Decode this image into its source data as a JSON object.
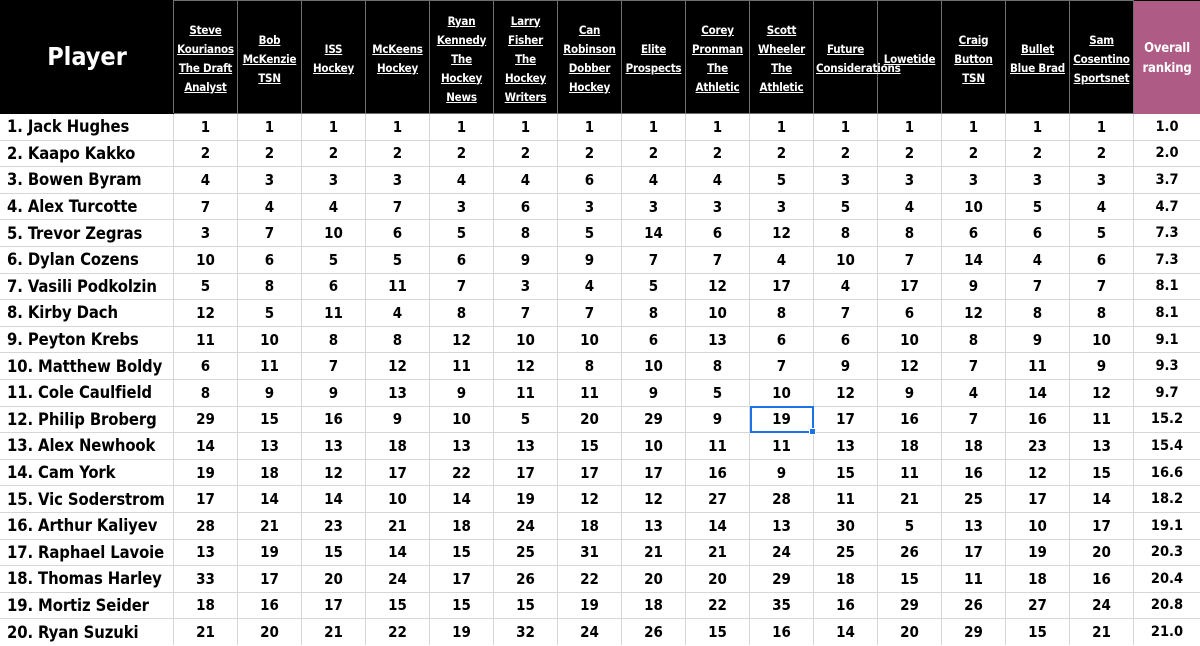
{
  "table": {
    "player_column_header": "Player",
    "overall_column_header": "Overall ranking",
    "accent_header_color": "#AE5C85",
    "header_bg_color": "#000000",
    "selection_color": "#1a73e8",
    "source_columns": [
      "Steve Kourianos The Draft Analyst",
      "Bob McKenzie TSN",
      "ISS Hockey",
      "McKeens Hockey",
      "Ryan Kennedy The Hockey News",
      "Larry Fisher The Hockey Writers",
      "Can Robinson Dobber Hockey",
      "Elite Prospects",
      "Corey Pronman The Athletic",
      "Scott Wheeler The Athletic",
      "Future Considerations",
      "Lowetide",
      "Craig Button TSN",
      "Bullet Blue Brad",
      "Sam Cosentino Sportsnet"
    ],
    "rows": [
      {
        "player": "1. Jack Hughes",
        "values": [
          "1",
          "1",
          "1",
          "1",
          "1",
          "1",
          "1",
          "1",
          "1",
          "1",
          "1",
          "1",
          "1",
          "1",
          "1"
        ],
        "overall": "1.0"
      },
      {
        "player": "2. Kaapo Kakko",
        "values": [
          "2",
          "2",
          "2",
          "2",
          "2",
          "2",
          "2",
          "2",
          "2",
          "2",
          "2",
          "2",
          "2",
          "2",
          "2"
        ],
        "overall": "2.0"
      },
      {
        "player": "3. Bowen Byram",
        "values": [
          "4",
          "3",
          "3",
          "3",
          "4",
          "4",
          "6",
          "4",
          "4",
          "5",
          "3",
          "3",
          "3",
          "3",
          "3"
        ],
        "overall": "3.7"
      },
      {
        "player": "4. Alex Turcotte",
        "values": [
          "7",
          "4",
          "4",
          "7",
          "3",
          "6",
          "3",
          "3",
          "3",
          "3",
          "5",
          "4",
          "10",
          "5",
          "4"
        ],
        "overall": "4.7"
      },
      {
        "player": "5. Trevor Zegras",
        "values": [
          "3",
          "7",
          "10",
          "6",
          "5",
          "8",
          "5",
          "14",
          "6",
          "12",
          "8",
          "8",
          "6",
          "6",
          "5"
        ],
        "overall": "7.3"
      },
      {
        "player": "6. Dylan Cozens",
        "values": [
          "10",
          "6",
          "5",
          "5",
          "6",
          "9",
          "9",
          "7",
          "7",
          "4",
          "10",
          "7",
          "14",
          "4",
          "6"
        ],
        "overall": "7.3"
      },
      {
        "player": "7. Vasili Podkolzin",
        "values": [
          "5",
          "8",
          "6",
          "11",
          "7",
          "3",
          "4",
          "5",
          "12",
          "17",
          "4",
          "17",
          "9",
          "7",
          "7"
        ],
        "overall": "8.1"
      },
      {
        "player": "8. Kirby Dach",
        "values": [
          "12",
          "5",
          "11",
          "4",
          "8",
          "7",
          "7",
          "8",
          "10",
          "8",
          "7",
          "6",
          "12",
          "8",
          "8"
        ],
        "overall": "8.1"
      },
      {
        "player": "9. Peyton Krebs",
        "values": [
          "11",
          "10",
          "8",
          "8",
          "12",
          "10",
          "10",
          "6",
          "13",
          "6",
          "6",
          "10",
          "8",
          "9",
          "10"
        ],
        "overall": "9.1"
      },
      {
        "player": "10. Matthew Boldy",
        "values": [
          "6",
          "11",
          "7",
          "12",
          "11",
          "12",
          "8",
          "10",
          "8",
          "7",
          "9",
          "12",
          "7",
          "11",
          "9"
        ],
        "overall": "9.3"
      },
      {
        "player": "11. Cole Caulfield",
        "values": [
          "8",
          "9",
          "9",
          "13",
          "9",
          "11",
          "11",
          "9",
          "5",
          "10",
          "12",
          "9",
          "4",
          "14",
          "12"
        ],
        "overall": "9.7"
      },
      {
        "player": "12. Philip Broberg",
        "values": [
          "29",
          "15",
          "16",
          "9",
          "10",
          "5",
          "20",
          "29",
          "9",
          "19",
          "17",
          "16",
          "7",
          "16",
          "11"
        ],
        "overall": "15.2"
      },
      {
        "player": "13. Alex Newhook",
        "values": [
          "14",
          "13",
          "13",
          "18",
          "13",
          "13",
          "15",
          "10",
          "11",
          "11",
          "13",
          "18",
          "18",
          "23",
          "13"
        ],
        "overall": "15.4"
      },
      {
        "player": "14. Cam York",
        "values": [
          "19",
          "18",
          "12",
          "17",
          "22",
          "17",
          "17",
          "17",
          "16",
          "9",
          "15",
          "11",
          "16",
          "12",
          "15"
        ],
        "overall": "16.6"
      },
      {
        "player": "15. Vic Soderstrom",
        "values": [
          "17",
          "14",
          "14",
          "10",
          "14",
          "19",
          "12",
          "12",
          "27",
          "28",
          "11",
          "21",
          "25",
          "17",
          "14"
        ],
        "overall": "18.2"
      },
      {
        "player": "16. Arthur Kaliyev",
        "values": [
          "28",
          "21",
          "23",
          "21",
          "18",
          "24",
          "18",
          "13",
          "14",
          "13",
          "30",
          "5",
          "13",
          "10",
          "17"
        ],
        "overall": "19.1"
      },
      {
        "player": "17. Raphael Lavoie",
        "values": [
          "13",
          "19",
          "15",
          "14",
          "15",
          "25",
          "31",
          "21",
          "21",
          "24",
          "25",
          "26",
          "17",
          "19",
          "20"
        ],
        "overall": "20.3"
      },
      {
        "player": "18. Thomas Harley",
        "values": [
          "33",
          "17",
          "20",
          "24",
          "17",
          "26",
          "22",
          "20",
          "20",
          "29",
          "18",
          "15",
          "11",
          "18",
          "16"
        ],
        "overall": "20.4"
      },
      {
        "player": "19. Mortiz Seider",
        "values": [
          "18",
          "16",
          "17",
          "15",
          "15",
          "15",
          "19",
          "18",
          "22",
          "35",
          "16",
          "29",
          "26",
          "27",
          "24"
        ],
        "overall": "20.8"
      },
      {
        "player": "20. Ryan Suzuki",
        "values": [
          "21",
          "20",
          "21",
          "22",
          "19",
          "32",
          "24",
          "26",
          "15",
          "16",
          "14",
          "20",
          "29",
          "15",
          "21"
        ],
        "overall": "21.0"
      }
    ],
    "selected_cell": {
      "row_player": "12. Philip Broberg",
      "column": "Scott Wheeler The Athletic",
      "value": "19"
    }
  }
}
